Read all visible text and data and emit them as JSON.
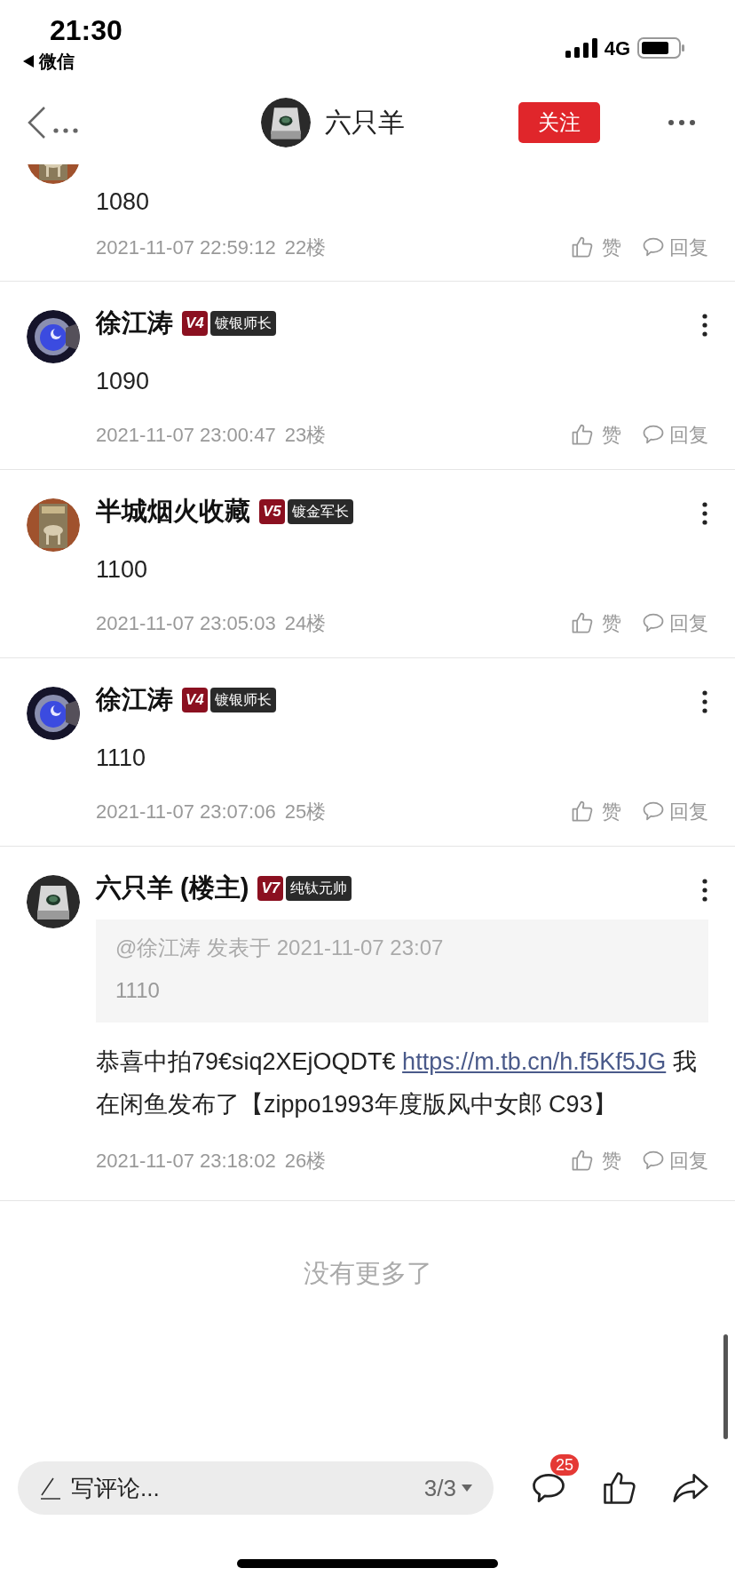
{
  "status_bar": {
    "time": "21:30",
    "back_app": "微信",
    "network": "4G"
  },
  "header": {
    "title": "六只羊",
    "follow": "关注"
  },
  "posts": [
    {
      "kind": "cut",
      "content": [
        {
          "kind": "text",
          "text": "1080"
        }
      ],
      "time": "2021-11-07 22:59:12",
      "floor": "22楼",
      "like": "赞",
      "reply": "回复"
    },
    {
      "kind": "full",
      "name": "徐江涛",
      "level": "V4",
      "title": "镀银师长",
      "content": [
        {
          "kind": "text",
          "text": "1090"
        }
      ],
      "time": "2021-11-07 23:00:47",
      "floor": "23楼",
      "like": "赞",
      "reply": "回复"
    },
    {
      "kind": "full",
      "name": "半城烟火收藏",
      "level": "V5",
      "title": "镀金军长",
      "content": [
        {
          "kind": "text",
          "text": "1100"
        }
      ],
      "time": "2021-11-07 23:05:03",
      "floor": "24楼",
      "like": "赞",
      "reply": "回复"
    },
    {
      "kind": "full",
      "name": "徐江涛",
      "level": "V4",
      "title": "镀银师长",
      "content": [
        {
          "kind": "text",
          "text": "1110"
        }
      ],
      "time": "2021-11-07 23:07:06",
      "floor": "25楼",
      "like": "赞",
      "reply": "回复"
    },
    {
      "kind": "full",
      "name": "六只羊 (楼主)",
      "level": "V7",
      "title": "纯钛元帅",
      "quote": {
        "meta": "@徐江涛 发表于 2021-11-07 23:07",
        "text": "1110"
      },
      "content": [
        {
          "kind": "text",
          "text": "恭喜中拍79€siq2XEjOQDT€ "
        },
        {
          "kind": "link",
          "text": "https://m.tb.cn/h.f5Kf5JG"
        },
        {
          "kind": "text",
          "text": "  我在闲鱼发布了【zippo1993年度版风中女郎 C93】"
        }
      ],
      "time": "2021-11-07 23:18:02",
      "floor": "26楼",
      "like": "赞",
      "reply": "回复"
    }
  ],
  "end_note": "没有更多了",
  "bottom_bar": {
    "placeholder": "写评论...",
    "page": "3/3",
    "comment_count": "25"
  }
}
